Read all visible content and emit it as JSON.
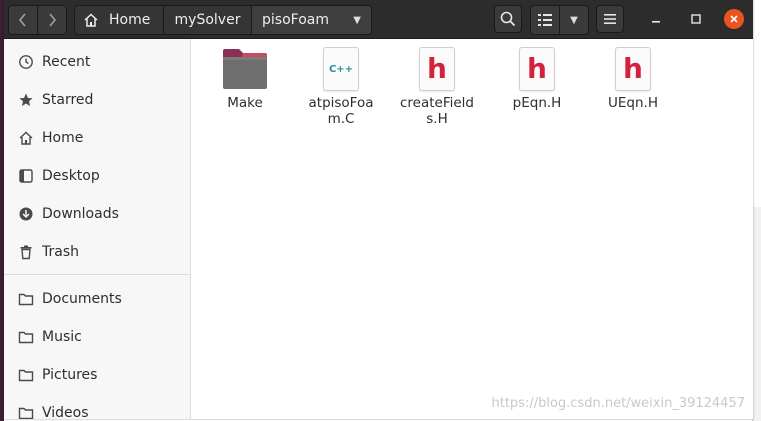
{
  "window": {
    "path": [
      "Home",
      "mySolver",
      "pisoFoam"
    ]
  },
  "sidebar": {
    "items": [
      {
        "label": "Recent",
        "icon": "clock-icon"
      },
      {
        "label": "Starred",
        "icon": "star-icon"
      },
      {
        "label": "Home",
        "icon": "home-icon"
      },
      {
        "label": "Desktop",
        "icon": "desktop-icon"
      },
      {
        "label": "Downloads",
        "icon": "download-icon"
      },
      {
        "label": "Trash",
        "icon": "trash-icon"
      },
      {
        "label": "Documents",
        "icon": "folder-icon"
      },
      {
        "label": "Music",
        "icon": "folder-icon"
      },
      {
        "label": "Pictures",
        "icon": "folder-icon"
      },
      {
        "label": "Videos",
        "icon": "folder-icon"
      }
    ]
  },
  "files": [
    {
      "name": "Make",
      "kind": "folder"
    },
    {
      "name": "atpisoFoam.C",
      "kind": "cpp",
      "badge": "C++"
    },
    {
      "name": "createFields.H",
      "kind": "header",
      "badge": "h"
    },
    {
      "name": "pEqn.H",
      "kind": "header",
      "badge": "h"
    },
    {
      "name": "UEqn.H",
      "kind": "header",
      "badge": "h"
    }
  ],
  "watermark": "https://blog.csdn.net/weixin_39124457",
  "colors": {
    "header": "#2c2c2c",
    "close_button": "#e95420",
    "header_file_badge": "#d4213d",
    "cpp_badge": "#2f8f9d",
    "folder_tab": "#8b2f55"
  }
}
